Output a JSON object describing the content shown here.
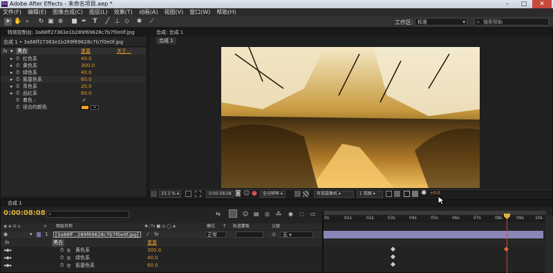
{
  "titlebar": {
    "title": "Adobe After Effects - 未命名项目.aep *",
    "logo": "Ae"
  },
  "menu": [
    "文件(F)",
    "编辑(E)",
    "图像合成(C)",
    "图层(L)",
    "效果(T)",
    "动画(A)",
    "视图(V)",
    "窗口(W)",
    "帮助(H)"
  ],
  "toolbar": {
    "workspace_label": "工作区:",
    "workspace_value": "标准",
    "search_placeholder": "搜索帮助"
  },
  "effects_panel": {
    "tab": "特效控制台: 3a68ff27363e1b289f69628c7b7f0e0f.jpg",
    "layer_path": "合成 1 • 3a68ff27363e1b289f69628c7b7f0e0f.jpg",
    "effect": {
      "fx": "fx",
      "name": "黑白",
      "reset": "重置",
      "about": "关于..."
    },
    "params": [
      {
        "name": "红色系",
        "value": "40.0"
      },
      {
        "name": "黄色系",
        "value": "300.0"
      },
      {
        "name": "绿色系",
        "value": "40.0"
      },
      {
        "name": "氰基色系",
        "value": "60.0"
      },
      {
        "name": "青色系",
        "value": "20.0"
      },
      {
        "name": "品红系",
        "value": "80.0"
      }
    ],
    "tint_label": "着色 :",
    "tint_check": "✓",
    "tint_color_label": "适合的颜色",
    "tint_color": "#e8a028"
  },
  "comp_panel": {
    "tab": "合成: 合成 1",
    "sub_tab": "合成 1",
    "footer": {
      "zoom": "33.3 %",
      "timecode": "0:00:08:08",
      "resolution": "全分辨率",
      "camera": "有效摄像机",
      "views": "1 视图",
      "offset": "+0.0"
    }
  },
  "timeline": {
    "tab": "合成 1",
    "timecode": "0:00:08:08",
    "search_placeholder": "",
    "header": {
      "layer_name": "图层名称",
      "mode": "模式",
      "trkmat": "轨道蒙板",
      "parent": "父级"
    },
    "layer": {
      "num": "1",
      "name": "[3a68ff...289f69628c7b7f0e0f.jpg]",
      "mode": "正常",
      "parent": "无"
    },
    "effect": {
      "fx": "fx",
      "name": "黑白",
      "reset": "重置"
    },
    "props": [
      {
        "name": "黄色系",
        "value": "300.0"
      },
      {
        "name": "绿色系",
        "value": "40.0"
      },
      {
        "name": "氰基色系",
        "value": "60.0"
      }
    ],
    "ticks": [
      "0s",
      "01s",
      "02s",
      "03s",
      "04s",
      "05s",
      "06s",
      "07s",
      "08s",
      "09s",
      "10s"
    ],
    "playhead_fraction": 0.833
  }
}
